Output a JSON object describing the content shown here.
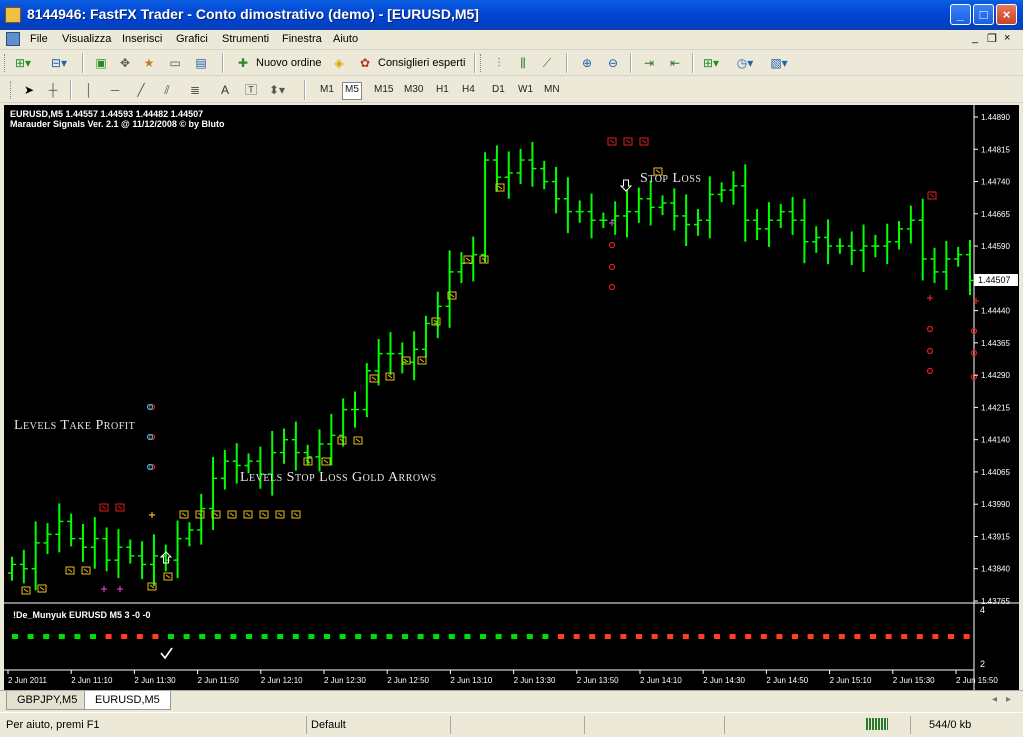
{
  "window": {
    "title": "8144946: FastFX Trader - Conto dimostrativo (demo) - [EURUSD,M5]",
    "minimize": "_",
    "maximize": "□",
    "close": "×"
  },
  "menu": {
    "items": [
      "File",
      "Visualizza",
      "Inserisci",
      "Grafici",
      "Strumenti",
      "Finestra",
      "Aiuto"
    ],
    "mdi_minimize": "_",
    "mdi_restore": "❐",
    "mdi_close": "×"
  },
  "toolbar": {
    "new_order": "Nuovo ordine",
    "expert_advisors": "Consiglieri esperti",
    "text_tool": "A",
    "timeframes": [
      "M1",
      "M5",
      "M15",
      "M30",
      "H1",
      "H4",
      "D1",
      "W1",
      "MN"
    ],
    "active_timeframe": "M5"
  },
  "chart": {
    "info_line1": "EURUSD,M5  1.44557 1.44593 1.44482 1.44507",
    "info_line2": "Marauder Signals Ver. 2.1 @ 11/12/2008  © by Bluto",
    "indicator_label": "!De_Munyuk EURUSD M5 3 -0 -0",
    "annotations": {
      "take_profit": "Levels Take Profit",
      "stop_loss_gold": "Levels Stop Loss Gold Arrows",
      "stop_loss": "Stop Loss"
    },
    "current_price": "1.44507",
    "indicator_scale_top": "4",
    "indicator_scale_bottom": "2"
  },
  "chart_data": {
    "type": "ohlc",
    "symbol": "EURUSD",
    "timeframe": "M5",
    "ylim": [
      1.43765,
      1.4489
    ],
    "y_ticks": [
      "1.44890",
      "1.44815",
      "1.44740",
      "1.44665",
      "1.44590",
      "1.44515",
      "1.44440",
      "1.44365",
      "1.44290",
      "1.44215",
      "1.44140",
      "1.44065",
      "1.43990",
      "1.43915",
      "1.43840",
      "1.43765"
    ],
    "x_ticks": [
      "2 Jun 2011",
      "2 Jun 11:10",
      "2 Jun 11:30",
      "2 Jun 11:50",
      "2 Jun 12:10",
      "2 Jun 12:30",
      "2 Jun 12:50",
      "2 Jun 13:10",
      "2 Jun 13:30",
      "2 Jun 13:50",
      "2 Jun 14:10",
      "2 Jun 14:30",
      "2 Jun 14:50",
      "2 Jun 15:10",
      "2 Jun 15:30",
      "2 Jun 15:50"
    ],
    "bar_color": "#00ff00",
    "ohlc_close": [
      1.4385,
      1.4384,
      1.439,
      1.4392,
      1.4395,
      1.4391,
      1.4389,
      1.4391,
      1.4386,
      1.4389,
      1.4387,
      1.4385,
      1.4387,
      1.4386,
      1.4391,
      1.4393,
      1.4398,
      1.4405,
      1.4409,
      1.4408,
      1.4409,
      1.4406,
      1.4411,
      1.4414,
      1.4411,
      1.441,
      1.4413,
      1.4415,
      1.4421,
      1.4421,
      1.443,
      1.4434,
      1.4434,
      1.4432,
      1.4435,
      1.4441,
      1.4445,
      1.4453,
      1.4455,
      1.4457,
      1.4479,
      1.4475,
      1.4476,
      1.4479,
      1.4477,
      1.4474,
      1.447,
      1.4467,
      1.4467,
      1.4465,
      1.4465,
      1.4466,
      1.4467,
      1.447,
      1.4468,
      1.4469,
      1.4466,
      1.4464,
      1.4465,
      1.4471,
      1.4472,
      1.4473,
      1.4465,
      1.4463,
      1.4465,
      1.4467,
      1.4465,
      1.446,
      1.4461,
      1.4459,
      1.4459,
      1.4458,
      1.4459,
      1.4459,
      1.446,
      1.4463,
      1.4465,
      1.4456,
      1.4453,
      1.4456,
      1.4457,
      1.4451
    ],
    "signal_dot_colors": {
      "buy": "#00e000",
      "sell": "#ff4020"
    }
  },
  "tabs": {
    "items": [
      "GBPJPY,M5",
      "EURUSD,M5"
    ],
    "active": "EURUSD,M5"
  },
  "status": {
    "help": "Per aiuto, premi F1",
    "profile": "Default",
    "traffic": "544/0 kb"
  }
}
